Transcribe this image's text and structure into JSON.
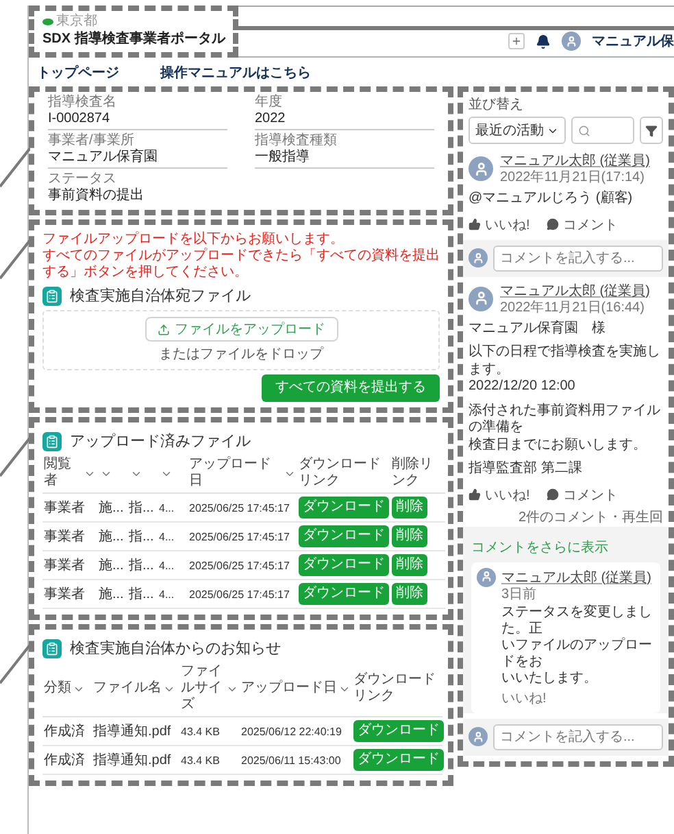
{
  "header": {
    "org": "東京都",
    "title": "SDX 指導検査事業者ポータル",
    "user": "マニュアル保"
  },
  "nav": [
    "トップページ",
    "操作マニュアルはこちら"
  ],
  "record": {
    "fields": [
      {
        "label": "指導検査名",
        "value": "I-0002874"
      },
      {
        "label": "年度",
        "value": "2022"
      },
      {
        "label": "事業者/事業所",
        "value": "マニュアル保育園"
      },
      {
        "label": "指導検査種類",
        "value": "一般指導"
      },
      {
        "label": "ステータス",
        "value": "事前資料の提出"
      }
    ]
  },
  "upload": {
    "notice": [
      "ファイルアップロードを以下からお願いします。",
      "すべてのファイルがアップロードできたら「すべての資料を提出する」ボタンを押してください。"
    ],
    "title": "検査実施自治体宛ファイル",
    "upload_button": "ファイルをアップロード",
    "drop_hint": "またはファイルをドロップ",
    "submit_button": "すべての資料を提出する"
  },
  "uploaded": {
    "title": "アップロード済みファイル",
    "columns": [
      {
        "label": "閲覧者",
        "sortable": true
      },
      {
        "sortable": true
      },
      {
        "sortable": true
      },
      {
        "sortable": true
      },
      {
        "label": "アップロード日",
        "sortable": true
      },
      {
        "label": "ダウンロードリンク",
        "sortable": false
      },
      {
        "label": "削除リンク",
        "sortable": false
      }
    ],
    "rows": [
      {
        "cells": [
          "事業者",
          "施...",
          "指...",
          "4...",
          "2025/06/25 17:45:17"
        ],
        "download": "ダウンロード",
        "delete": "削除"
      },
      {
        "cells": [
          "事業者",
          "施...",
          "指...",
          "4...",
          "2025/06/25 17:45:17"
        ],
        "download": "ダウンロード",
        "delete": "削除"
      },
      {
        "cells": [
          "事業者",
          "施...",
          "指...",
          "4...",
          "2025/06/25 17:45:17"
        ],
        "download": "ダウンロード",
        "delete": "削除"
      },
      {
        "cells": [
          "事業者",
          "施...",
          "指...",
          "4...",
          "2025/06/25 17:45:17"
        ],
        "download": "ダウンロード",
        "delete": "削除"
      }
    ]
  },
  "notices": {
    "title": "検査実施自治体からのお知らせ",
    "columns": [
      {
        "label": "分類",
        "sortable": true
      },
      {
        "label": "ファイル名",
        "sortable": true
      },
      {
        "label": "ファイルサイズ",
        "sortable": true
      },
      {
        "label": "アップロード日",
        "sortable": true
      },
      {
        "label": "ダウンロードリンク",
        "sortable": false
      }
    ],
    "rows": [
      {
        "cells": [
          "作成済",
          "指導通知.pdf",
          "43.4 KB",
          "2025/06/12 22:40:19"
        ],
        "download": "ダウンロード"
      },
      {
        "cells": [
          "作成済",
          "指導通知.pdf",
          "43.4 KB",
          "2025/06/11 15:43:00"
        ],
        "download": "ダウンロード"
      }
    ]
  },
  "feed": {
    "sort_label": "並び替え",
    "sort_value": "最近の活動",
    "posts": [
      {
        "author": "マニュアル太郎 (従業員)",
        "time": "2022年11月21日(17:14)",
        "body": [
          [
            "@マニュアルじろう (顧客)"
          ]
        ],
        "like": "いいね!",
        "comment": "コメント",
        "comment_placeholder": "コメントを記入する..."
      },
      {
        "author": "マニュアル太郎 (従業員)",
        "time": "2022年11月21日(16:44)",
        "body": [
          [
            "マニュアル保育園　様"
          ],
          [
            "以下の日程で指導検査を実施します。",
            "2022/12/20 12:00"
          ],
          [
            "添付された事前資料用ファイルの準備を",
            "検査日までにお願いします。"
          ],
          [
            "指導監査部 第二課"
          ]
        ],
        "like": "いいね!",
        "comment": "コメント",
        "counts": "2件のコメント・再生回",
        "more_comments": "コメントをさらに表示",
        "replies": [
          {
            "author": "マニュアル太郎 (従業員)",
            "time": "3日前",
            "lines": [
              "ステータスを変更しました。正",
              "いファイルのアップロードをお",
              "いいたします。"
            ],
            "like": "いいね!"
          }
        ],
        "comment_placeholder": "コメントを記入する..."
      }
    ]
  }
}
